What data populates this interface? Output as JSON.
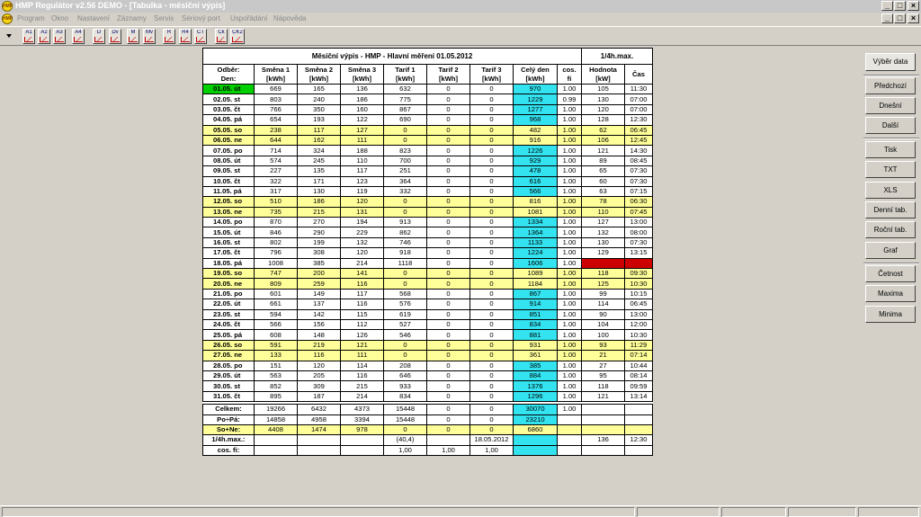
{
  "window": {
    "title": "HMP Regulátor v2.56 DEMO - [Tabulka - měsiční výpis]",
    "logo_text": "HMP"
  },
  "menu": {
    "items": [
      "Program",
      "Okno",
      "Nastavení",
      "Záznamy",
      "Servis",
      "Sériový port",
      "Uspořádání",
      "Nápověda"
    ]
  },
  "toolbar": {
    "buttons": [
      "A1",
      "A2",
      "A3",
      "A4",
      "D",
      "Dv",
      "M",
      "Mv",
      "R",
      "R4",
      "CT",
      "Ck",
      "CK2"
    ]
  },
  "report": {
    "title": "Měsiční výpis - HMP - Hlavní měření  01.05.2012",
    "max_title": "1/4h.max.",
    "headers": {
      "col0": [
        "Odběr:",
        "Den:"
      ],
      "smena1": [
        "Směna 1",
        "[kWh]"
      ],
      "smena2": [
        "Směna 2",
        "[kWh]"
      ],
      "smena3": [
        "Směna 3",
        "[kWh]"
      ],
      "tarif1": [
        "Tarif 1",
        "[kWh]"
      ],
      "tarif2": [
        "Tarif 2",
        "[kWh]"
      ],
      "tarif3": [
        "Tarif 3",
        "[kWh]"
      ],
      "celyden": [
        "Celý den",
        "[kWh]"
      ],
      "cosfi": [
        "cos.",
        "fi"
      ],
      "hodnota": [
        "Hodnota",
        "[kW]"
      ],
      "cas": [
        "Čas",
        ""
      ]
    },
    "rows": [
      [
        "01.05. út",
        "669",
        "165",
        "136",
        "632",
        "0",
        "0",
        "970",
        "1.00",
        "105",
        "11:30"
      ],
      [
        "02.05. st",
        "803",
        "240",
        "186",
        "775",
        "0",
        "0",
        "1229",
        "0.99",
        "130",
        "07:00"
      ],
      [
        "03.05. čt",
        "766",
        "350",
        "160",
        "867",
        "0",
        "0",
        "1277",
        "1.00",
        "120",
        "07:00"
      ],
      [
        "04.05. pá",
        "654",
        "193",
        "122",
        "690",
        "0",
        "0",
        "968",
        "1.00",
        "128",
        "12:30"
      ],
      [
        "05.05. so",
        "238",
        "117",
        "127",
        "0",
        "0",
        "0",
        "482",
        "1.00",
        "62",
        "06:45"
      ],
      [
        "06.05. ne",
        "644",
        "162",
        "111",
        "0",
        "0",
        "0",
        "916",
        "1.00",
        "106",
        "12:45"
      ],
      [
        "07.05. po",
        "714",
        "324",
        "188",
        "823",
        "0",
        "0",
        "1226",
        "1.00",
        "121",
        "14:30"
      ],
      [
        "08.05. út",
        "574",
        "245",
        "110",
        "700",
        "0",
        "0",
        "929",
        "1.00",
        "89",
        "08:45"
      ],
      [
        "09.05. st",
        "227",
        "135",
        "117",
        "251",
        "0",
        "0",
        "478",
        "1.00",
        "65",
        "07:30"
      ],
      [
        "10.05. čt",
        "322",
        "171",
        "123",
        "364",
        "0",
        "0",
        "616",
        "1.00",
        "60",
        "07:30"
      ],
      [
        "11.05. pá",
        "317",
        "130",
        "119",
        "332",
        "0",
        "0",
        "566",
        "1.00",
        "63",
        "07:15"
      ],
      [
        "12.05. so",
        "510",
        "186",
        "120",
        "0",
        "0",
        "0",
        "816",
        "1.00",
        "78",
        "06:30"
      ],
      [
        "13.05. ne",
        "735",
        "215",
        "131",
        "0",
        "0",
        "0",
        "1081",
        "1.00",
        "110",
        "07:45"
      ],
      [
        "14.05. po",
        "870",
        "270",
        "194",
        "913",
        "0",
        "0",
        "1334",
        "1.00",
        "127",
        "13:00"
      ],
      [
        "15.05. út",
        "846",
        "290",
        "229",
        "862",
        "0",
        "0",
        "1364",
        "1.00",
        "132",
        "08:00"
      ],
      [
        "16.05. st",
        "802",
        "199",
        "132",
        "746",
        "0",
        "0",
        "1133",
        "1.00",
        "130",
        "07:30"
      ],
      [
        "17.05. čt",
        "796",
        "308",
        "120",
        "918",
        "0",
        "0",
        "1224",
        "1.00",
        "129",
        "13:15"
      ],
      [
        "18.05. pá",
        "1008",
        "385",
        "214",
        "1118",
        "0",
        "0",
        "1606",
        "1.00",
        "136",
        "12:30"
      ],
      [
        "19.05. so",
        "747",
        "200",
        "141",
        "0",
        "0",
        "0",
        "1089",
        "1.00",
        "118",
        "09:30"
      ],
      [
        "20.05. ne",
        "809",
        "259",
        "116",
        "0",
        "0",
        "0",
        "1184",
        "1.00",
        "125",
        "10:30"
      ],
      [
        "21.05. po",
        "601",
        "149",
        "117",
        "568",
        "0",
        "0",
        "867",
        "1.00",
        "99",
        "10:15"
      ],
      [
        "22.05. út",
        "661",
        "137",
        "116",
        "576",
        "0",
        "0",
        "914",
        "1.00",
        "114",
        "06:45"
      ],
      [
        "23.05. st",
        "594",
        "142",
        "115",
        "619",
        "0",
        "0",
        "851",
        "1.00",
        "90",
        "13:00"
      ],
      [
        "24.05. čt",
        "566",
        "156",
        "112",
        "527",
        "0",
        "0",
        "834",
        "1.00",
        "104",
        "12:00"
      ],
      [
        "25.05. pá",
        "608",
        "148",
        "126",
        "546",
        "0",
        "0",
        "881",
        "1.00",
        "100",
        "10:30"
      ],
      [
        "26.05. so",
        "591",
        "219",
        "121",
        "0",
        "0",
        "0",
        "931",
        "1.00",
        "93",
        "11:29"
      ],
      [
        "27.05. ne",
        "133",
        "116",
        "111",
        "0",
        "0",
        "0",
        "361",
        "1.00",
        "21",
        "07:14"
      ],
      [
        "28.05. po",
        "151",
        "120",
        "114",
        "208",
        "0",
        "0",
        "385",
        "1.00",
        "27",
        "10:44"
      ],
      [
        "29.05. út",
        "563",
        "205",
        "116",
        "646",
        "0",
        "0",
        "884",
        "1.00",
        "95",
        "08:14"
      ],
      [
        "30.05. st",
        "852",
        "309",
        "215",
        "933",
        "0",
        "0",
        "1376",
        "1.00",
        "118",
        "09:59"
      ],
      [
        "31.05. čt",
        "895",
        "187",
        "214",
        "834",
        "0",
        "0",
        "1296",
        "1.00",
        "121",
        "13:14"
      ]
    ],
    "weekend_rows": [
      4,
      5,
      11,
      12,
      18,
      19,
      25,
      26
    ],
    "max_row": 17,
    "totals": {
      "celkem": [
        "Celkem:",
        "19266",
        "6432",
        "4373",
        "15448",
        "0",
        "0",
        "30070",
        "1.00",
        "",
        ""
      ],
      "popa": [
        "Po÷Pá:",
        "14858",
        "4958",
        "3394",
        "15448",
        "0",
        "0",
        "23210",
        "",
        "",
        ""
      ],
      "sone": [
        "So+Ne:",
        "4408",
        "1474",
        "978",
        "0",
        "0",
        "0",
        "6860",
        "",
        "",
        ""
      ],
      "max": [
        "1/4h.max.:",
        "",
        "",
        "",
        "(40,4)",
        "",
        "18.05.2012",
        "",
        "",
        "136",
        "12:30"
      ],
      "cos": [
        "cos. fi:",
        "",
        "",
        "",
        "1,00",
        "1,00",
        "1,00",
        "",
        "",
        "",
        ""
      ]
    }
  },
  "colors": {
    "weekend": "#ffff99",
    "celyden": "#33e3f0",
    "today": "#00d000",
    "max": "#cc0000"
  },
  "sidebar": {
    "buttons": [
      "Výběr data",
      "Předchozí",
      "Dnešní",
      "Další",
      "Tisk",
      "TXT",
      "XLS",
      "Denní tab.",
      "Roční tab.",
      "Graf",
      "Četnost",
      "Maxima",
      "Minima"
    ]
  }
}
